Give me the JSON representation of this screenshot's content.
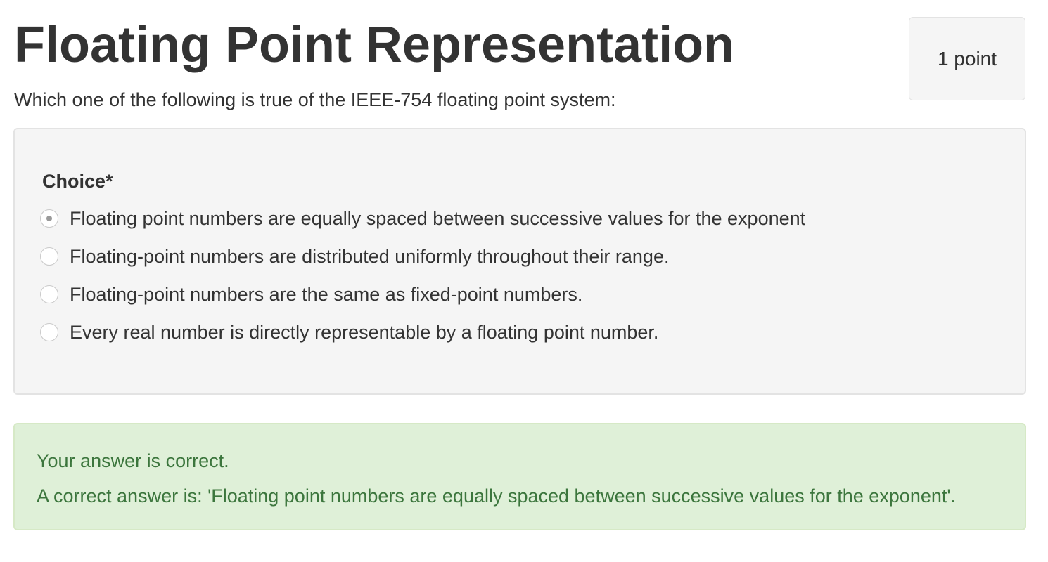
{
  "question": {
    "title": "Floating Point Representation",
    "points": "1 point",
    "prompt": "Which one of the following is true of the IEEE-754 floating point system:"
  },
  "choices": {
    "label": "Choice*",
    "selected_index": 0,
    "options": [
      "Floating point numbers are equally spaced between successive values for the exponent",
      "Floating-point numbers are distributed uniformly throughout their range.",
      "Floating-point numbers are the same as fixed-point numbers.",
      "Every real number is directly representable by a floating point number."
    ]
  },
  "feedback": {
    "status": "Your answer is correct.",
    "answer": "A correct answer is: 'Floating point numbers are equally spaced between successive values for the exponent'."
  },
  "colors": {
    "text": "#333333",
    "panel_background": "#f5f5f5",
    "success_background": "#dff0d8",
    "success_text": "#3c763d"
  }
}
